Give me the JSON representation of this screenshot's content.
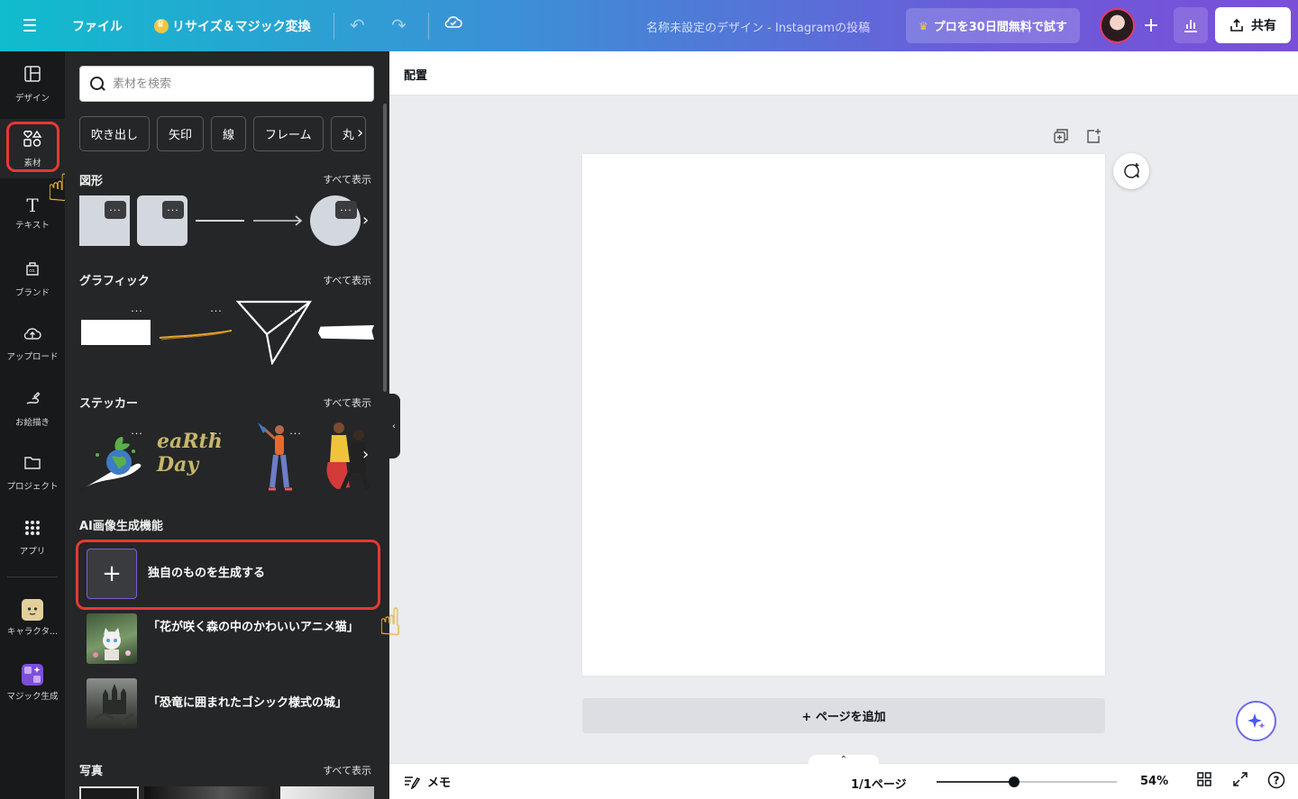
{
  "topbar": {
    "file_label": "ファイル",
    "resize_label": "リサイズ＆マジック変換",
    "doc_title": "名称未設定のデザイン - Instagramの投稿",
    "pro_trial_label": "プロを30日間無料で試す",
    "share_label": "共有"
  },
  "rail": {
    "items": [
      {
        "label": "デザイン",
        "icon": "layout-icon"
      },
      {
        "label": "素材",
        "icon": "elements-icon"
      },
      {
        "label": "テキスト",
        "icon": "text-icon"
      },
      {
        "label": "ブランド",
        "icon": "brand-icon"
      },
      {
        "label": "アップロード",
        "icon": "upload-icon"
      },
      {
        "label": "お絵描き",
        "icon": "draw-icon"
      },
      {
        "label": "プロジェクト",
        "icon": "folder-icon"
      },
      {
        "label": "アプリ",
        "icon": "apps-grid-icon"
      },
      {
        "label": "キャラクタ...",
        "icon": "character-app-icon"
      },
      {
        "label": "マジック生成",
        "icon": "magic-media-icon"
      }
    ]
  },
  "panel": {
    "search_placeholder": "素材を検索",
    "chips": [
      "吹き出し",
      "矢印",
      "線",
      "フレーム",
      "丸"
    ],
    "see_all": "すべて表示",
    "sections": {
      "shapes": "図形",
      "graphics": "グラフィック",
      "stickers": "ステッカー",
      "ai": "AI画像生成機能",
      "photos": "写真"
    },
    "sticker_earth_day": "eaRth Day",
    "ai_generate_label": "独自のものを生成する",
    "ai_prompts": [
      "「花が咲く森の中のかわいいアニメ猫」",
      "「恐竜に囲まれたゴシック様式の城」"
    ],
    "more_glyph": "···"
  },
  "canvas": {
    "arrange_label": "配置",
    "add_page_label": "+ ページを追加"
  },
  "footer": {
    "notes_label": "メモ",
    "page_count": "1/1ページ",
    "zoom_value": "54%",
    "zoom_fraction": 0.43
  },
  "colors": {
    "highlight": "#e53935",
    "panel_bg": "#252627",
    "rail_bg": "#18191b",
    "accent_purple": "#7c5dd6"
  }
}
